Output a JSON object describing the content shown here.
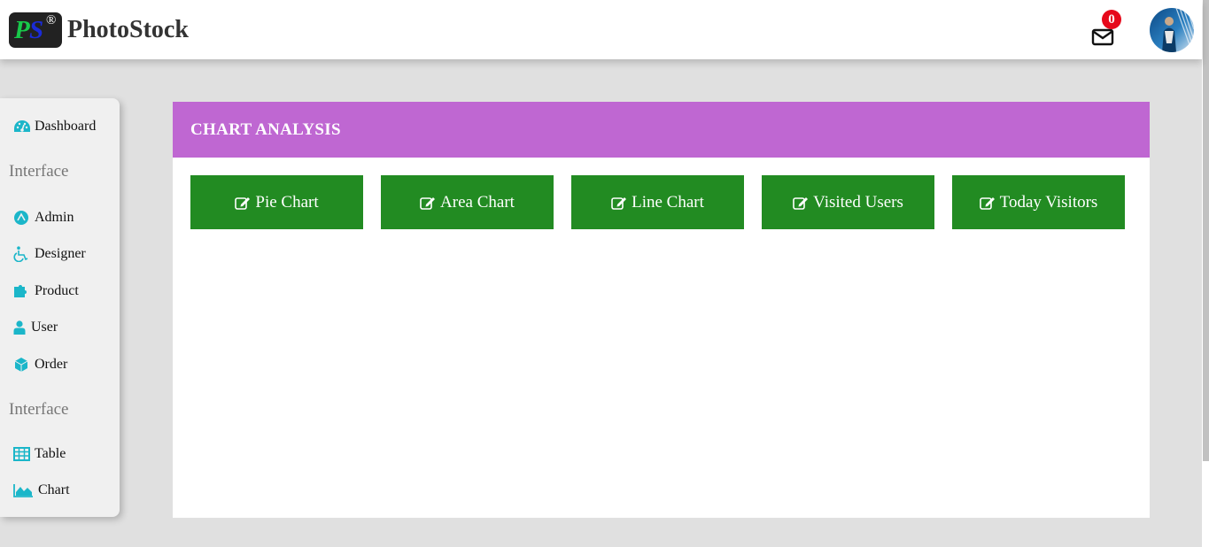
{
  "brand": {
    "logo_p": "P",
    "logo_s": "S",
    "logo_reg": "®",
    "name": "PhotoStock"
  },
  "header": {
    "mail_icon": "mail-icon",
    "mail_count": "0",
    "avatar_icon": "user-avatar"
  },
  "sidebar": {
    "items_top": [
      {
        "label": "Dashboard",
        "icon": "dashboard-gauge-icon"
      }
    ],
    "heading_1": "Interface",
    "items_mid": [
      {
        "label": "Admin",
        "icon": "admin-circle-icon"
      },
      {
        "label": "Designer",
        "icon": "wheelchair-icon"
      },
      {
        "label": "Product",
        "icon": "puzzle-icon"
      },
      {
        "label": "User",
        "icon": "user-icon"
      },
      {
        "label": "Order",
        "icon": "cube-icon"
      }
    ],
    "heading_2": "Interface",
    "items_bottom": [
      {
        "label": "Table",
        "icon": "table-icon"
      },
      {
        "label": "Chart",
        "icon": "area-chart-icon"
      }
    ]
  },
  "panel": {
    "title": "CHART ANALYSIS",
    "buttons": [
      {
        "label": "Pie Chart",
        "icon": "edit-icon"
      },
      {
        "label": "Area Chart",
        "icon": "edit-icon"
      },
      {
        "label": "Line Chart",
        "icon": "edit-icon"
      },
      {
        "label": "Visited Users",
        "icon": "edit-icon"
      },
      {
        "label": "Today Visitors",
        "icon": "edit-icon"
      }
    ]
  },
  "colors": {
    "accent_header": "#bf67d2",
    "button_green": "#228b22",
    "icon_teal": "#1bb6c9",
    "badge_red": "#e6091b"
  }
}
